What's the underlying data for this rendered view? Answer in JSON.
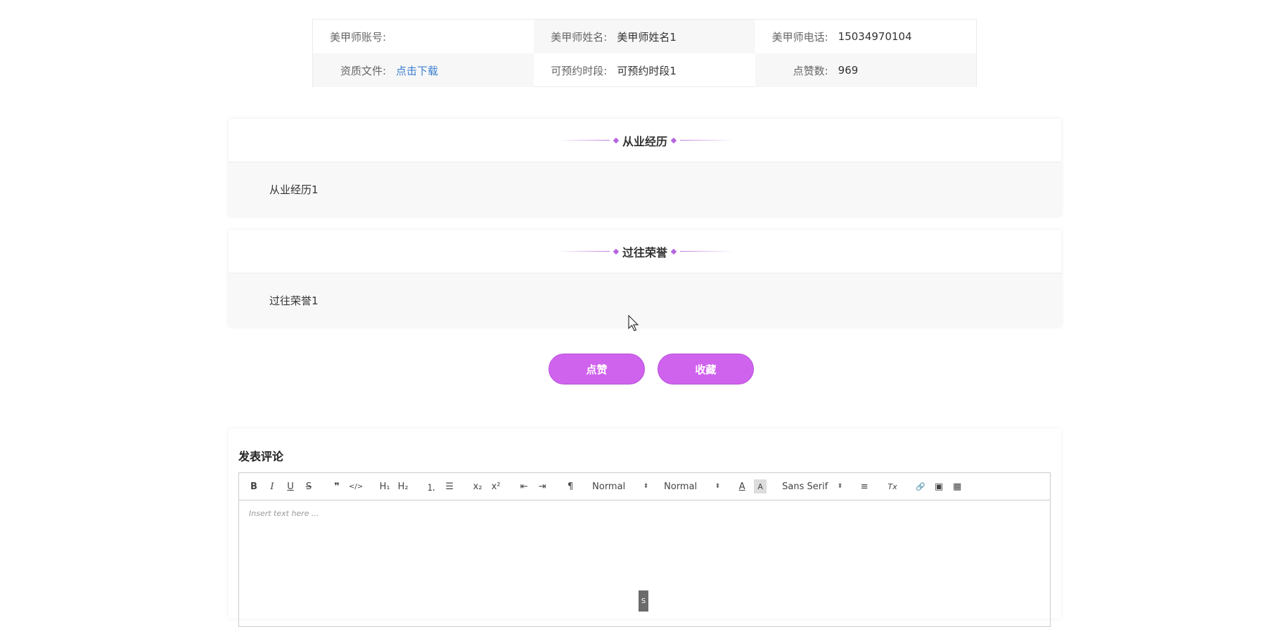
{
  "info": {
    "account_label": "美甲师账号:",
    "account_value": "",
    "name_label": "美甲师姓名:",
    "name_value": "美甲师姓名1",
    "phone_label": "美甲师电话:",
    "phone_value": "15034970104",
    "file_label": "资质文件:",
    "file_link": "点击下载",
    "slot_label": "可预约时段:",
    "slot_value": "可预约时段1",
    "likes_label": "点赞数:",
    "likes_value": "969"
  },
  "experience": {
    "title": "从业经历",
    "content": "从业经历1"
  },
  "honors": {
    "title": "过往荣誉",
    "content": "过往荣誉1"
  },
  "actions": {
    "like_label": "点赞",
    "favorite_label": "收藏"
  },
  "comment": {
    "title": "发表评论",
    "placeholder": "Insert text here ...",
    "toolbar": {
      "bold": "B",
      "italic": "I",
      "underline": "U",
      "strike": "S",
      "blockquote": "❞",
      "code": "</>",
      "h1": "H₁",
      "h2": "H₂",
      "ordered_list": "⒈",
      "bullet_list": "☰",
      "subscript": "x₂",
      "superscript": "x²",
      "outdent": "⇤",
      "indent": "⇥",
      "direction": "¶",
      "size_select": "Normal",
      "header_select": "Normal",
      "color": "A",
      "background": "A",
      "font_select": "Sans Serif",
      "align": "≡",
      "clean": "Tx",
      "link": "🔗",
      "image": "▣",
      "video": "▦"
    }
  },
  "badge": "S"
}
